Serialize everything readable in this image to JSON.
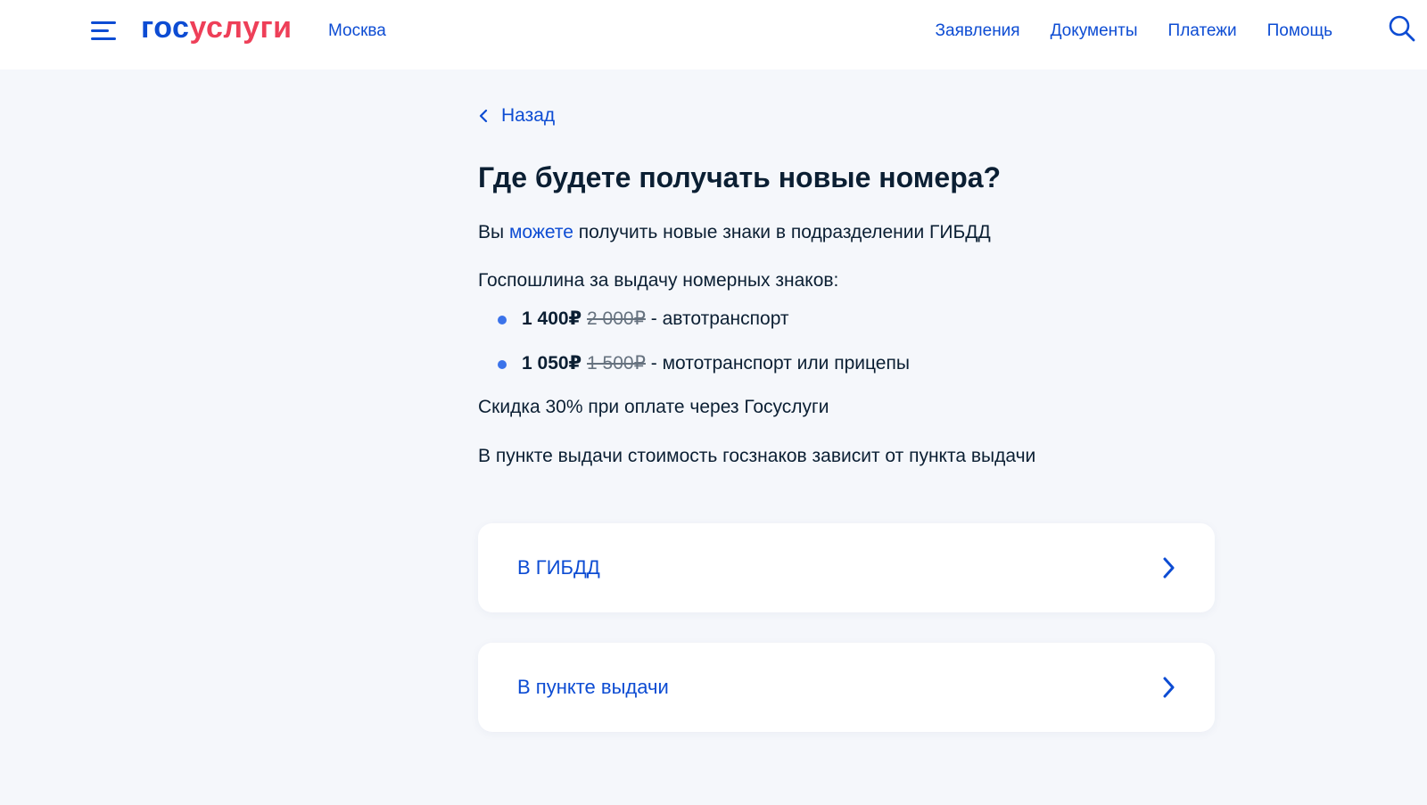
{
  "header": {
    "logo_part1": "гос",
    "logo_part2": "услуги",
    "city": "Москва",
    "nav": [
      "Заявления",
      "Документы",
      "Платежи",
      "Помощь"
    ]
  },
  "main": {
    "back_label": "Назад",
    "title": "Где будете получать новые номера?",
    "intro_before": "Вы ",
    "intro_link": "можете",
    "intro_after": " получить новые знаки в подразделении ГИБДД",
    "fee_heading": "Госпошлина за выдачу номерных знаков:",
    "fees": [
      {
        "price": "1 400₽",
        "old_price": "2 000₽",
        "desc": " - автотранспорт"
      },
      {
        "price": "1 050₽",
        "old_price": "1 500₽",
        "desc": " - мототранспорт или прицепы"
      }
    ],
    "discount_text": "Скидка 30% при оплате через Госуслуги",
    "pickup_text": "В пункте выдачи стоимость госзнаков зависит от пункта выдачи"
  },
  "options": [
    {
      "label": "В ГИБДД"
    },
    {
      "label": "В пункте выдачи"
    }
  ],
  "colors": {
    "accent": "#0d4cd3",
    "logo_red": "#ee3f58",
    "text": "#0b1f33",
    "muted": "#66727f",
    "bullet": "#3b73ea",
    "page_bg": "#f5f7fb"
  }
}
